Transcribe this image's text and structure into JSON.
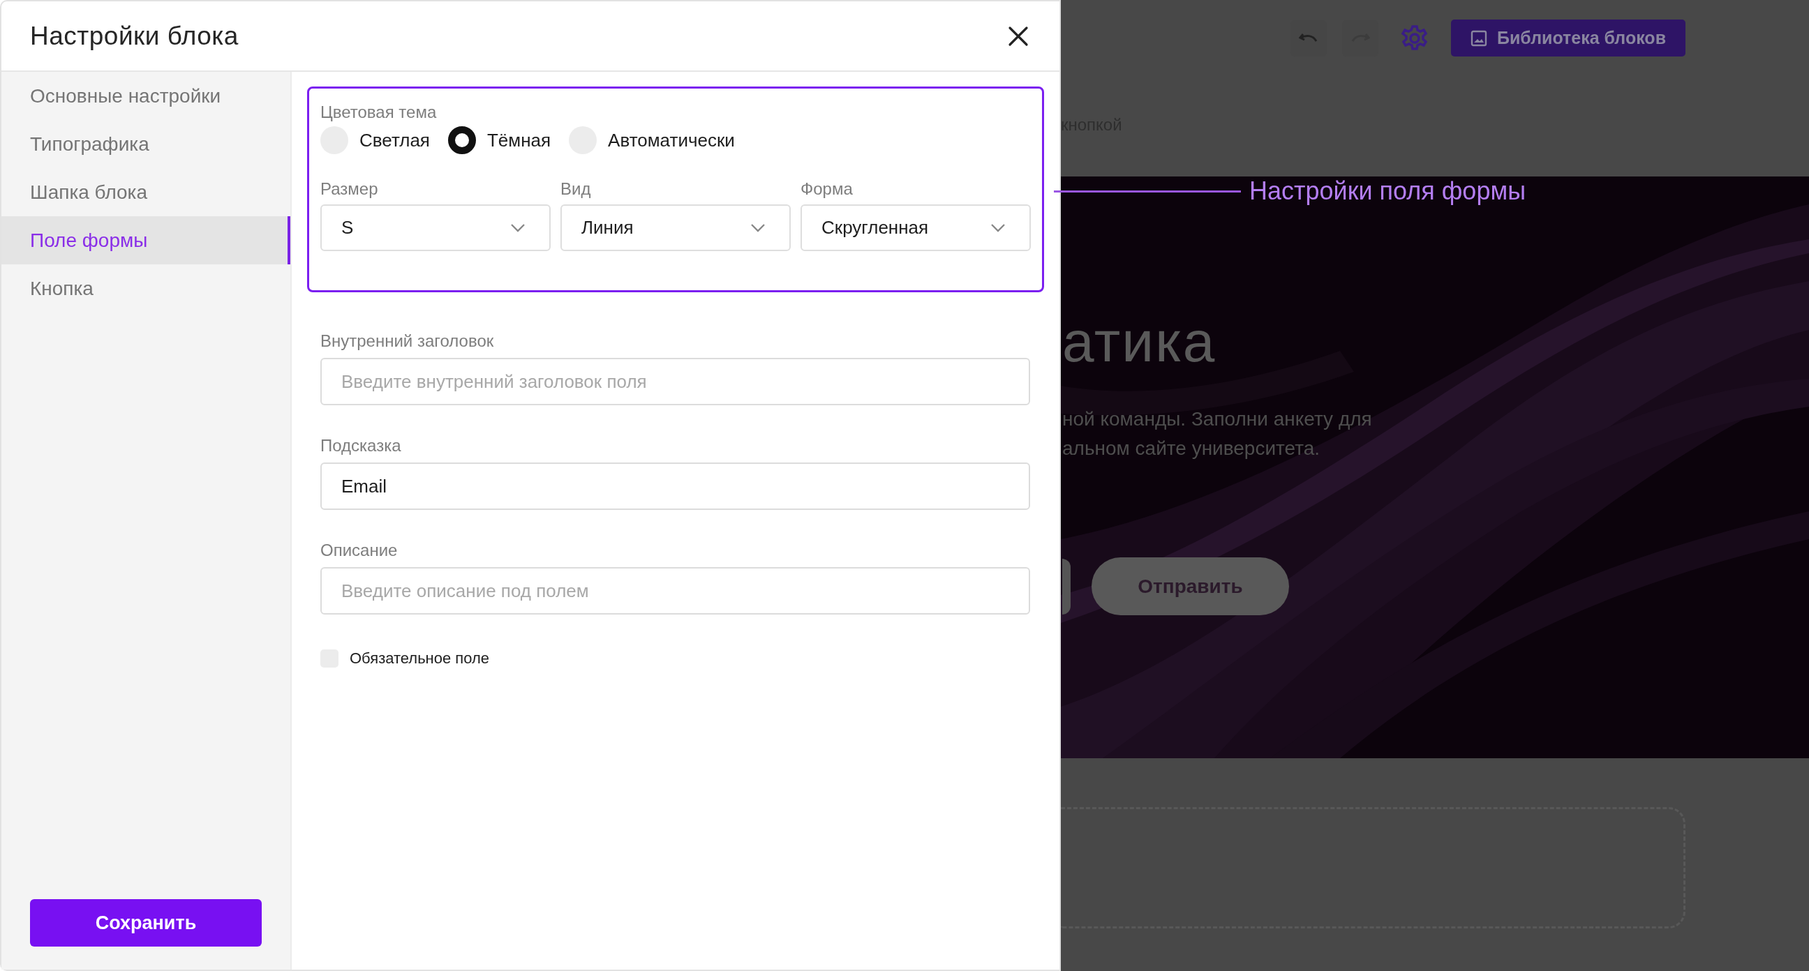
{
  "dialog": {
    "title": "Настройки блока"
  },
  "sidebar": {
    "items": [
      {
        "label": "Основные настройки",
        "selected": false
      },
      {
        "label": "Типографика",
        "selected": false
      },
      {
        "label": "Шапка блока",
        "selected": false
      },
      {
        "label": "Поле формы",
        "selected": true
      },
      {
        "label": "Кнопка",
        "selected": false
      }
    ]
  },
  "save_button": "Сохранить",
  "theme": {
    "label": "Цветовая тема",
    "options": [
      {
        "label": "Светлая",
        "selected": false
      },
      {
        "label": "Тёмная",
        "selected": true
      },
      {
        "label": "Автоматически",
        "selected": false
      }
    ]
  },
  "selects": [
    {
      "label": "Размер",
      "value": "S"
    },
    {
      "label": "Вид",
      "value": "Линия"
    },
    {
      "label": "Форма",
      "value": "Скругленная"
    }
  ],
  "fields": [
    {
      "label": "Внутренний заголовок",
      "placeholder": "Введите внутренний заголовок поля"
    },
    {
      "label": "Подсказка",
      "value": "Email"
    },
    {
      "label": "Описание",
      "placeholder": "Введите описание под полем"
    }
  ],
  "required_checkbox": {
    "label": "Обязательное поле",
    "checked": false
  },
  "callout": "Настройки поля формы",
  "background": {
    "library_button": "Библиотека блоков",
    "caption": "кнопкой",
    "hero": {
      "kind": "picture",
      "heading": "атика",
      "text_lines": [
        "ной команды. Заполни анкету для",
        "альном сайте университета."
      ],
      "submit_button": "Отправить"
    }
  }
}
